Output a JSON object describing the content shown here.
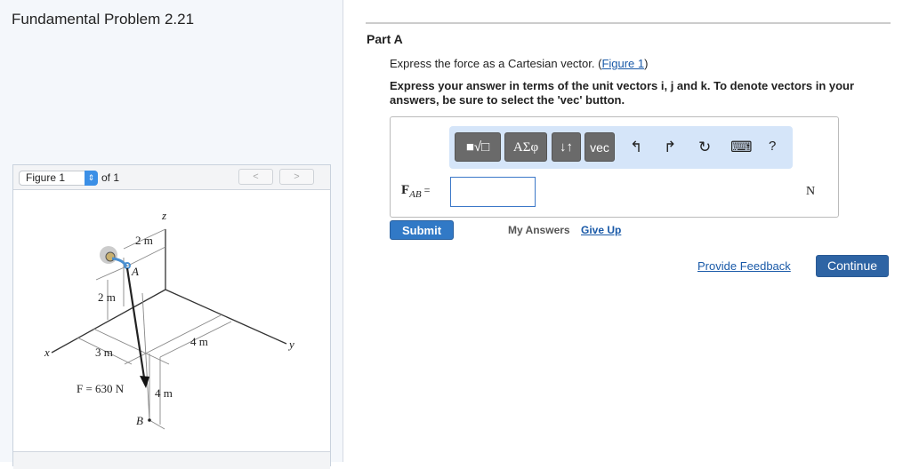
{
  "title": "Fundamental Problem 2.21",
  "figure": {
    "selector_value": "Figure 1",
    "of_label": "of 1",
    "prev": "<",
    "next": ">",
    "labels": {
      "z": "z",
      "x": "x",
      "y": "y",
      "top_2m": "2 m",
      "a": "A",
      "left_2m": "2 m",
      "x_3m": "3 m",
      "y_4m": "4 m",
      "force": "F = 630 N",
      "down_4m": "4 m",
      "b": "B"
    }
  },
  "part": {
    "title": "Part A",
    "prompt": "Express the force as a Cartesian vector. (",
    "figure_link": "Figure 1",
    "prompt_end": ")",
    "instructions": "Express your answer in terms of the unit vectors i, j and k. To denote vectors in your answers, be sure to select the 'vec' button."
  },
  "toolbar": {
    "templates": "■√□",
    "greek": "ΑΣφ",
    "arrows": "↓↑",
    "vec": "vec",
    "undo": "↰",
    "redo": "↱",
    "reset": "↻",
    "keyboard": "⌨",
    "help": "?"
  },
  "answer": {
    "label": "F",
    "subscript": "AB",
    "equals": " =",
    "value": "",
    "unit": "N"
  },
  "buttons": {
    "submit": "Submit",
    "my_answers": "My Answers",
    "give_up": "Give Up",
    "feedback": "Provide Feedback",
    "continue": "Continue"
  }
}
